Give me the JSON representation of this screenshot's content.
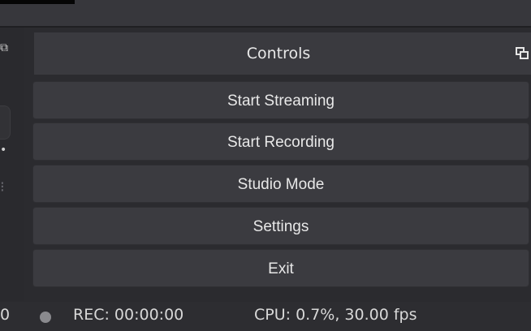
{
  "header": {
    "panel_title": "Controls"
  },
  "controls": {
    "buttons": [
      {
        "label": "Start Streaming"
      },
      {
        "label": "Start Recording"
      },
      {
        "label": "Studio Mode"
      },
      {
        "label": "Settings"
      },
      {
        "label": "Exit"
      }
    ]
  },
  "status": {
    "left_fragment": "0",
    "rec_time": "REC: 00:00:00",
    "cpu": "CPU: 0.7%, 30.00 fps"
  },
  "icons": {
    "float_dock": "float-dock-icon",
    "rec_status": "record-status-icon"
  },
  "colors": {
    "background": "#2b2b2f",
    "button": "#3b3b40",
    "text": "#e8e8e8"
  }
}
